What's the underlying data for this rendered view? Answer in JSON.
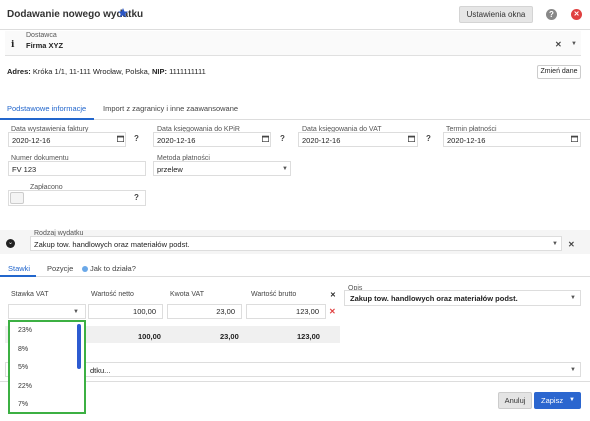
{
  "header": {
    "title": "Dodawanie nowego wydatku",
    "settings_label": "Ustawienia okna",
    "help_label": "?",
    "close_label": "✕"
  },
  "supplier": {
    "label": "Dostawca",
    "value": "Firma XYZ",
    "clear": "✕",
    "address_label": "Adres:",
    "address_value": "Króka 1/1, 11-111 Wrocław, Polska,",
    "nip_label": "NIP:",
    "nip_value": "1111111111",
    "change_button": "Zmień dane"
  },
  "tabs_main": [
    "Podstawowe informacje",
    "Import z zagranicy i inne zaawansowane"
  ],
  "dates": {
    "issue": {
      "label": "Data wystawienia faktury",
      "value": "2020-12-16"
    },
    "kpir": {
      "label": "Data księgowania do KPiR",
      "value": "2020-12-16"
    },
    "vat": {
      "label": "Data księgowania do VAT",
      "value": "2020-12-16"
    },
    "due": {
      "label": "Termin płatności",
      "value": "2020-12-16"
    },
    "help": "?"
  },
  "document": {
    "label": "Numer dokumentu",
    "value": "FV 123"
  },
  "payment": {
    "label": "Metoda płatności",
    "value": "przelew"
  },
  "paid": {
    "label": "Zapłacono",
    "help": "?"
  },
  "expense_type": {
    "label": "Rodzaj wydatku",
    "value": "Zakup tow. handlowych oraz materiałów podst.",
    "clear": "✕"
  },
  "tabs_sub": {
    "rates": "Stawki",
    "items": "Pozycje",
    "how": "Jak to działa?"
  },
  "table": {
    "headers": [
      "Stawka VAT",
      "Wartość netto",
      "Kwota VAT",
      "Wartość brutto"
    ],
    "row": {
      "netto": "100,00",
      "vat": "23,00",
      "brutto": "123,00"
    },
    "totals": {
      "netto": "100,00",
      "vat": "23,00",
      "brutto": "123,00"
    },
    "remove": "✕",
    "header_x": "✕"
  },
  "description": {
    "label": "Opis",
    "value": "Zakup tow. handlowych oraz materiałów podst."
  },
  "vat_options": [
    "23%",
    "8%",
    "5%",
    "22%",
    "7%"
  ],
  "bottom_select_partial": "dtku...",
  "footer": {
    "cancel": "Anuluj",
    "save": "Zapisz"
  },
  "colors": {
    "accent": "#2266cc",
    "danger": "#e04040",
    "dropdown_border": "#3cb043"
  }
}
